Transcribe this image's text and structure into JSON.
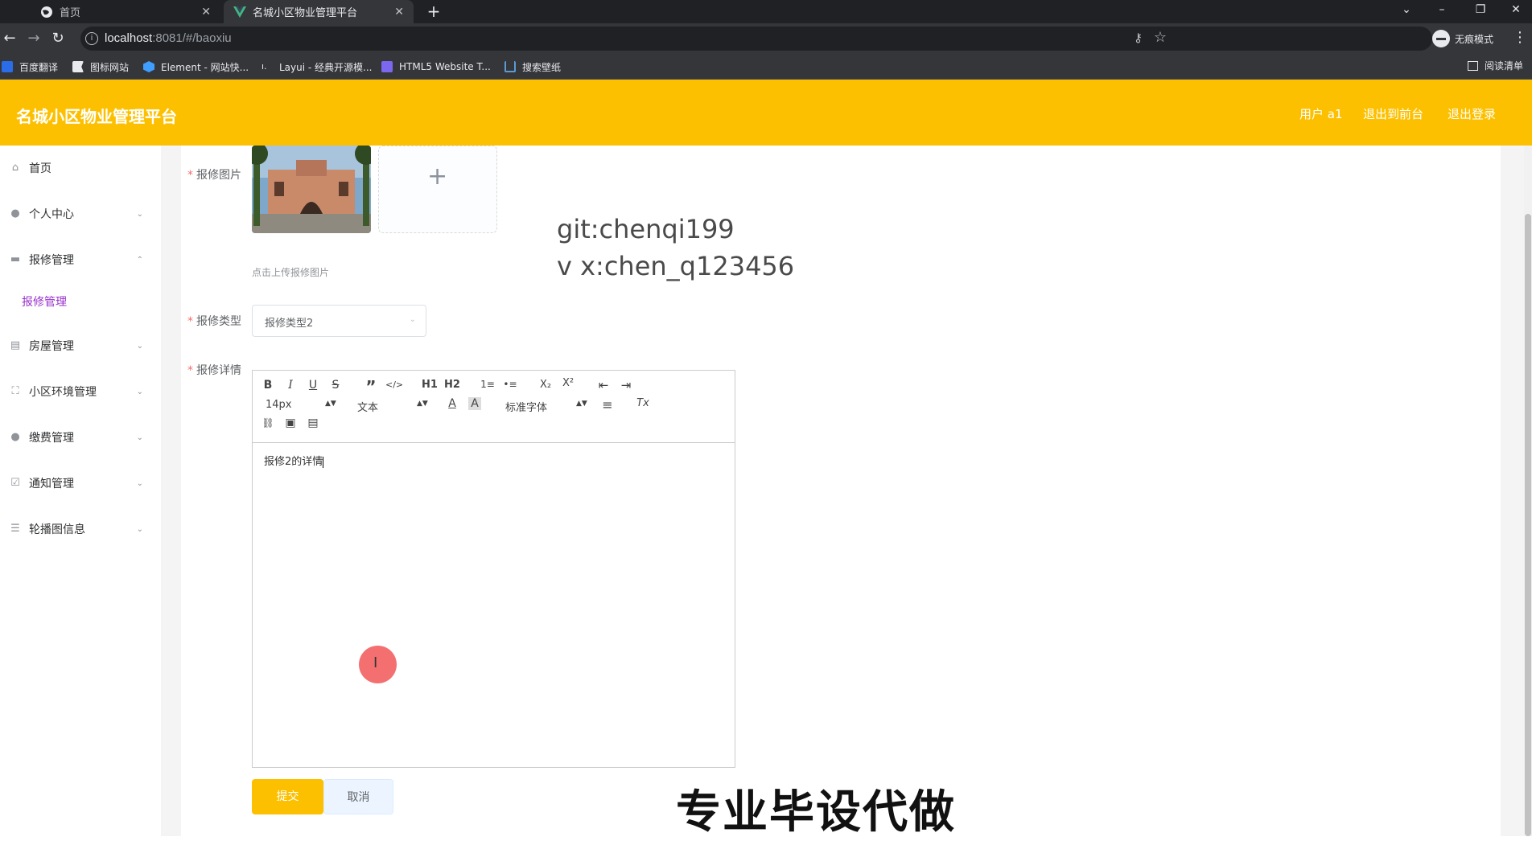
{
  "browser": {
    "tabs": [
      {
        "title": "首页",
        "active": false
      },
      {
        "title": "名城小区物业管理平台",
        "active": true
      }
    ],
    "new_tab": "+",
    "url_host": "localhost",
    "url_rest": ":8081/#/baoxiu",
    "incognito_label": "无痕模式",
    "bookmarks": [
      "百度翻译",
      "图标网站",
      "Element - 网站快...",
      "Layui - 经典开源模...",
      "HTML5 Website T...",
      "搜索壁纸"
    ],
    "reading_list": "阅读清单",
    "colors": {
      "tabbar": "#202124",
      "toolbar": "#35363a"
    }
  },
  "header": {
    "title": "名城小区物业管理平台",
    "user": "用户 a1",
    "to_front": "退出到前台",
    "logout": "退出登录",
    "color": "#fcc000"
  },
  "sidebar": {
    "items": [
      {
        "label": "首页",
        "icon": "home-icon",
        "expandable": false
      },
      {
        "label": "个人中心",
        "icon": "user-icon",
        "expandable": true,
        "expanded": false
      },
      {
        "label": "报修管理",
        "icon": "briefcase-icon",
        "expandable": true,
        "expanded": true
      },
      {
        "label": "房屋管理",
        "icon": "document-icon",
        "expandable": true,
        "expanded": false
      },
      {
        "label": "小区环境管理",
        "icon": "fullscreen-icon",
        "expandable": true,
        "expanded": false
      },
      {
        "label": "缴费管理",
        "icon": "location-icon",
        "expandable": true,
        "expanded": false
      },
      {
        "label": "通知管理",
        "icon": "checkbox-icon",
        "expandable": true,
        "expanded": false
      },
      {
        "label": "轮播图信息",
        "icon": "list-icon",
        "expandable": true,
        "expanded": false
      }
    ],
    "active_submenu": "报修管理"
  },
  "form": {
    "image_label": "报修图片",
    "upload_tip": "点击上传报修图片",
    "upload_add": "+",
    "type_label": "报修类型",
    "type_value": "报修类型2",
    "detail_label": "报修详情",
    "required_mark": "*",
    "detail_content": "报修2的详情",
    "toolbar": {
      "font_size": "14px",
      "header": "文本",
      "font_family": "标准字体",
      "bold": "B",
      "italic": "I",
      "underline": "U",
      "strike": "S",
      "quote": "”",
      "code": "</>",
      "h1": "H1",
      "h2": "H2",
      "ol": "1≡",
      "ul": "•≡",
      "sub": "X₂",
      "sup": "X²",
      "outdent": "⇤",
      "indent": "⇥",
      "color": "A",
      "background": "A",
      "align": "≡",
      "clean": "Tx",
      "link": "🔗",
      "image": "▣",
      "video": "▤"
    },
    "submit": "提交",
    "cancel": "取消"
  },
  "watermark": {
    "line1": "git:chenqi199",
    "line2": "v x:chen_q123456"
  },
  "overlay": "专业毕设代做"
}
